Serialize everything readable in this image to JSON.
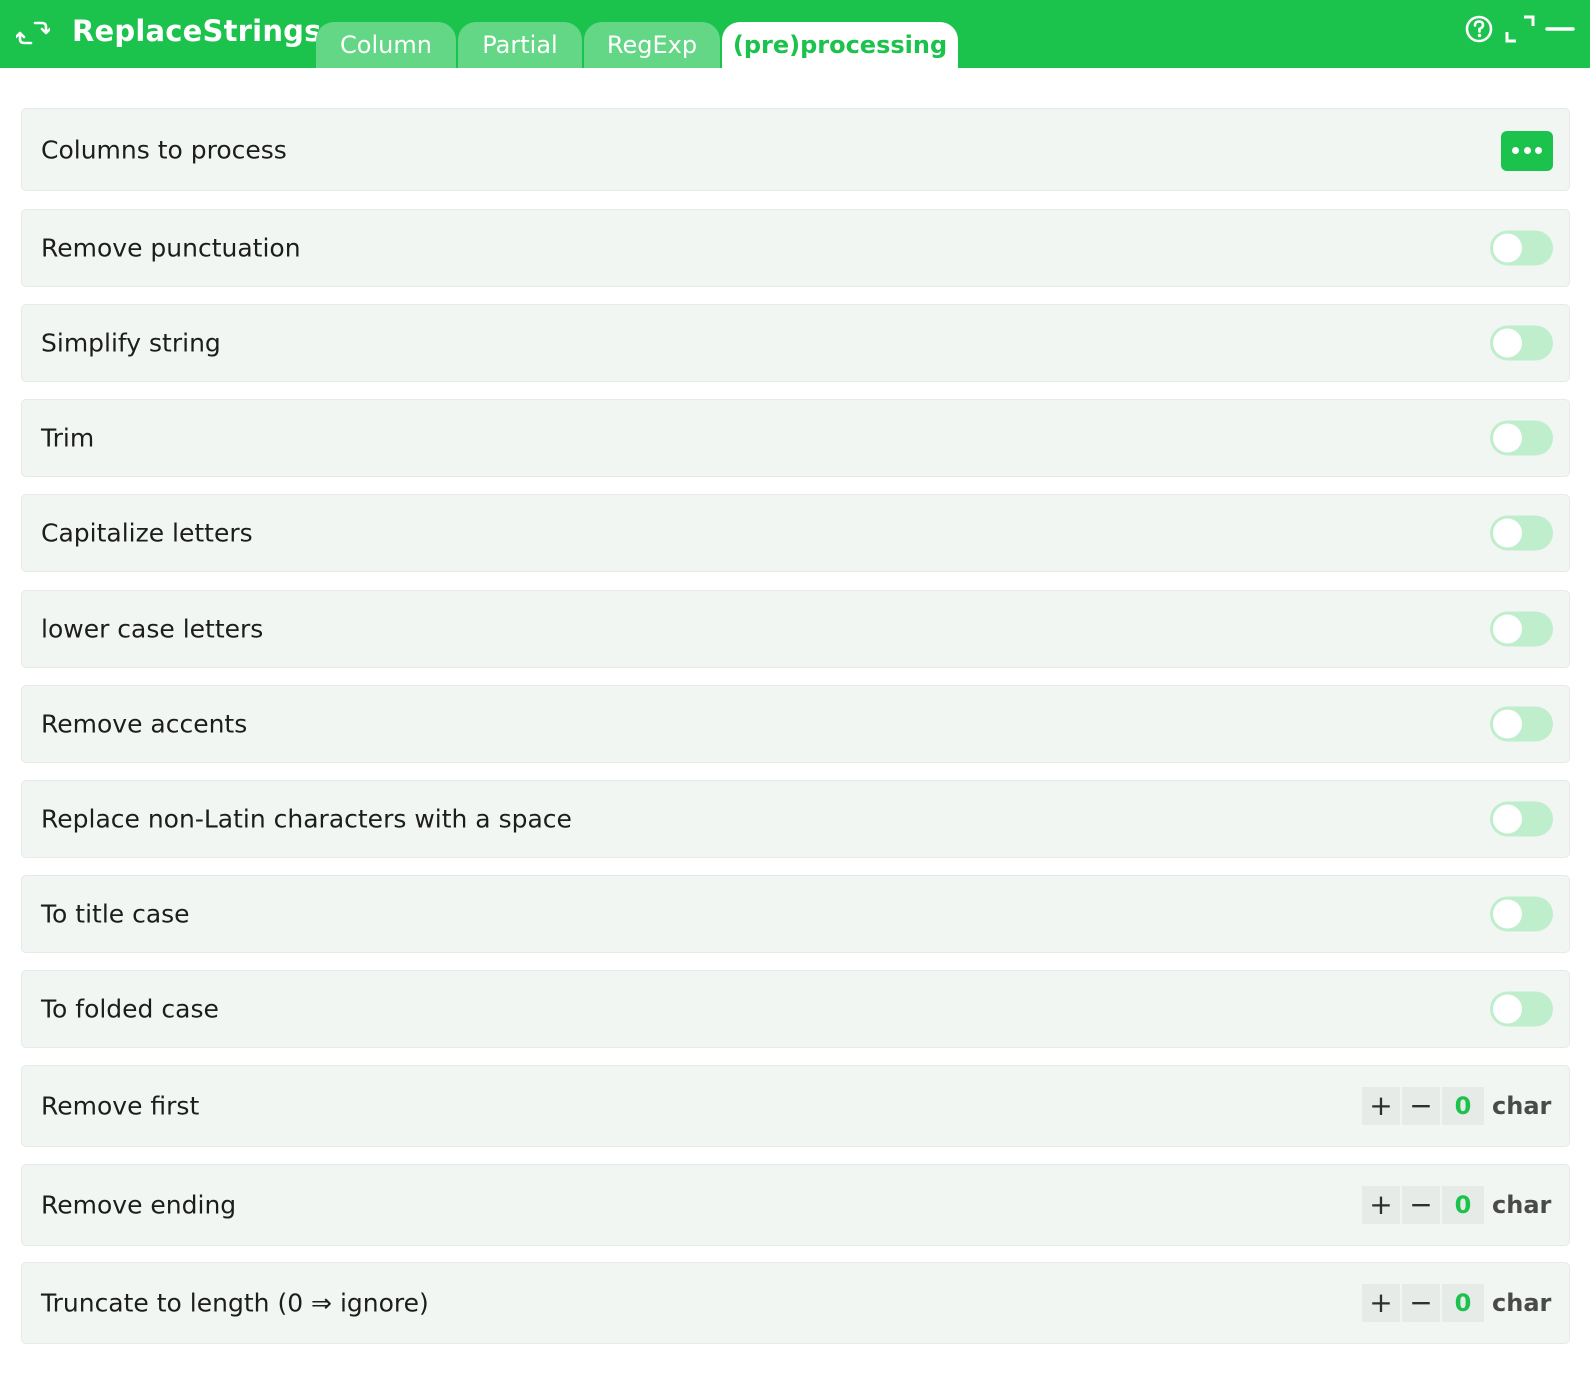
{
  "app": {
    "title": "ReplaceStrings",
    "icon": "refresh-arrows-icon"
  },
  "tabs": [
    {
      "label": "Column",
      "active": false
    },
    {
      "label": "Partial",
      "active": false
    },
    {
      "label": "RegExp",
      "active": false
    },
    {
      "label": "(pre)processing",
      "active": true
    }
  ],
  "window_controls": [
    "help-icon",
    "maximize-icon",
    "minimize-icon"
  ],
  "colors": {
    "accent": "#1bc24c",
    "tab_inactive": "#63d785",
    "toggle_off": "#bfeecc",
    "row_bg": "#f2f6f3"
  },
  "rows": {
    "columns": {
      "label": "Columns to process",
      "button_icon": "more-dots-icon"
    },
    "toggles": [
      {
        "label": "Remove punctuation",
        "on": false
      },
      {
        "label": "Simplify string",
        "on": false
      },
      {
        "label": "Trim",
        "on": false
      },
      {
        "label": "Capitalize letters",
        "on": false
      },
      {
        "label": "lower case letters",
        "on": false
      },
      {
        "label": "Remove accents",
        "on": false
      },
      {
        "label": "Replace non-Latin characters with a space",
        "on": false
      },
      {
        "label": "To title case",
        "on": false
      },
      {
        "label": "To folded case",
        "on": false
      }
    ],
    "steppers": [
      {
        "label": "Remove first",
        "plus": "+",
        "minus": "−",
        "value": "0",
        "unit": "char"
      },
      {
        "label": "Remove ending",
        "plus": "+",
        "minus": "−",
        "value": "0",
        "unit": "char"
      },
      {
        "label": "Truncate to length (0 ⇒ ignore)",
        "plus": "+",
        "minus": "−",
        "value": "0",
        "unit": "char"
      }
    ]
  }
}
